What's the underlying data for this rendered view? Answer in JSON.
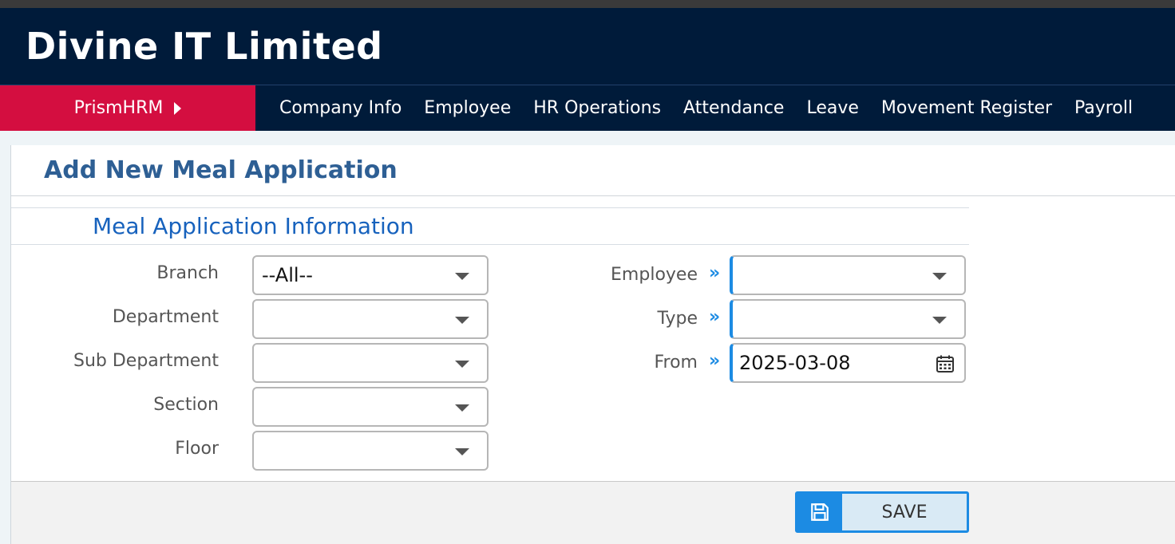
{
  "header": {
    "title": "Divine IT Limited"
  },
  "nav": {
    "brand": "PrismHRM",
    "items": [
      "Company Info",
      "Employee",
      "HR Operations",
      "Attendance",
      "Leave",
      "Movement Register",
      "Payroll"
    ]
  },
  "page": {
    "title": "Add New Meal Application",
    "section_title": "Meal Application Information"
  },
  "form": {
    "left": [
      {
        "label": "Branch",
        "value": "--All--"
      },
      {
        "label": "Department",
        "value": ""
      },
      {
        "label": "Sub Department",
        "value": ""
      },
      {
        "label": "Section",
        "value": ""
      },
      {
        "label": "Floor",
        "value": ""
      }
    ],
    "right": [
      {
        "label": "Employee",
        "value": ""
      },
      {
        "label": "Type",
        "value": ""
      },
      {
        "label": "From",
        "value": "2025-03-08"
      }
    ]
  },
  "footer": {
    "save_label": "SAVE"
  },
  "colors": {
    "header_bg": "#001b3a",
    "brand_bg": "#d40e40",
    "accent": "#1c8be3",
    "title": "#2e5f94"
  }
}
